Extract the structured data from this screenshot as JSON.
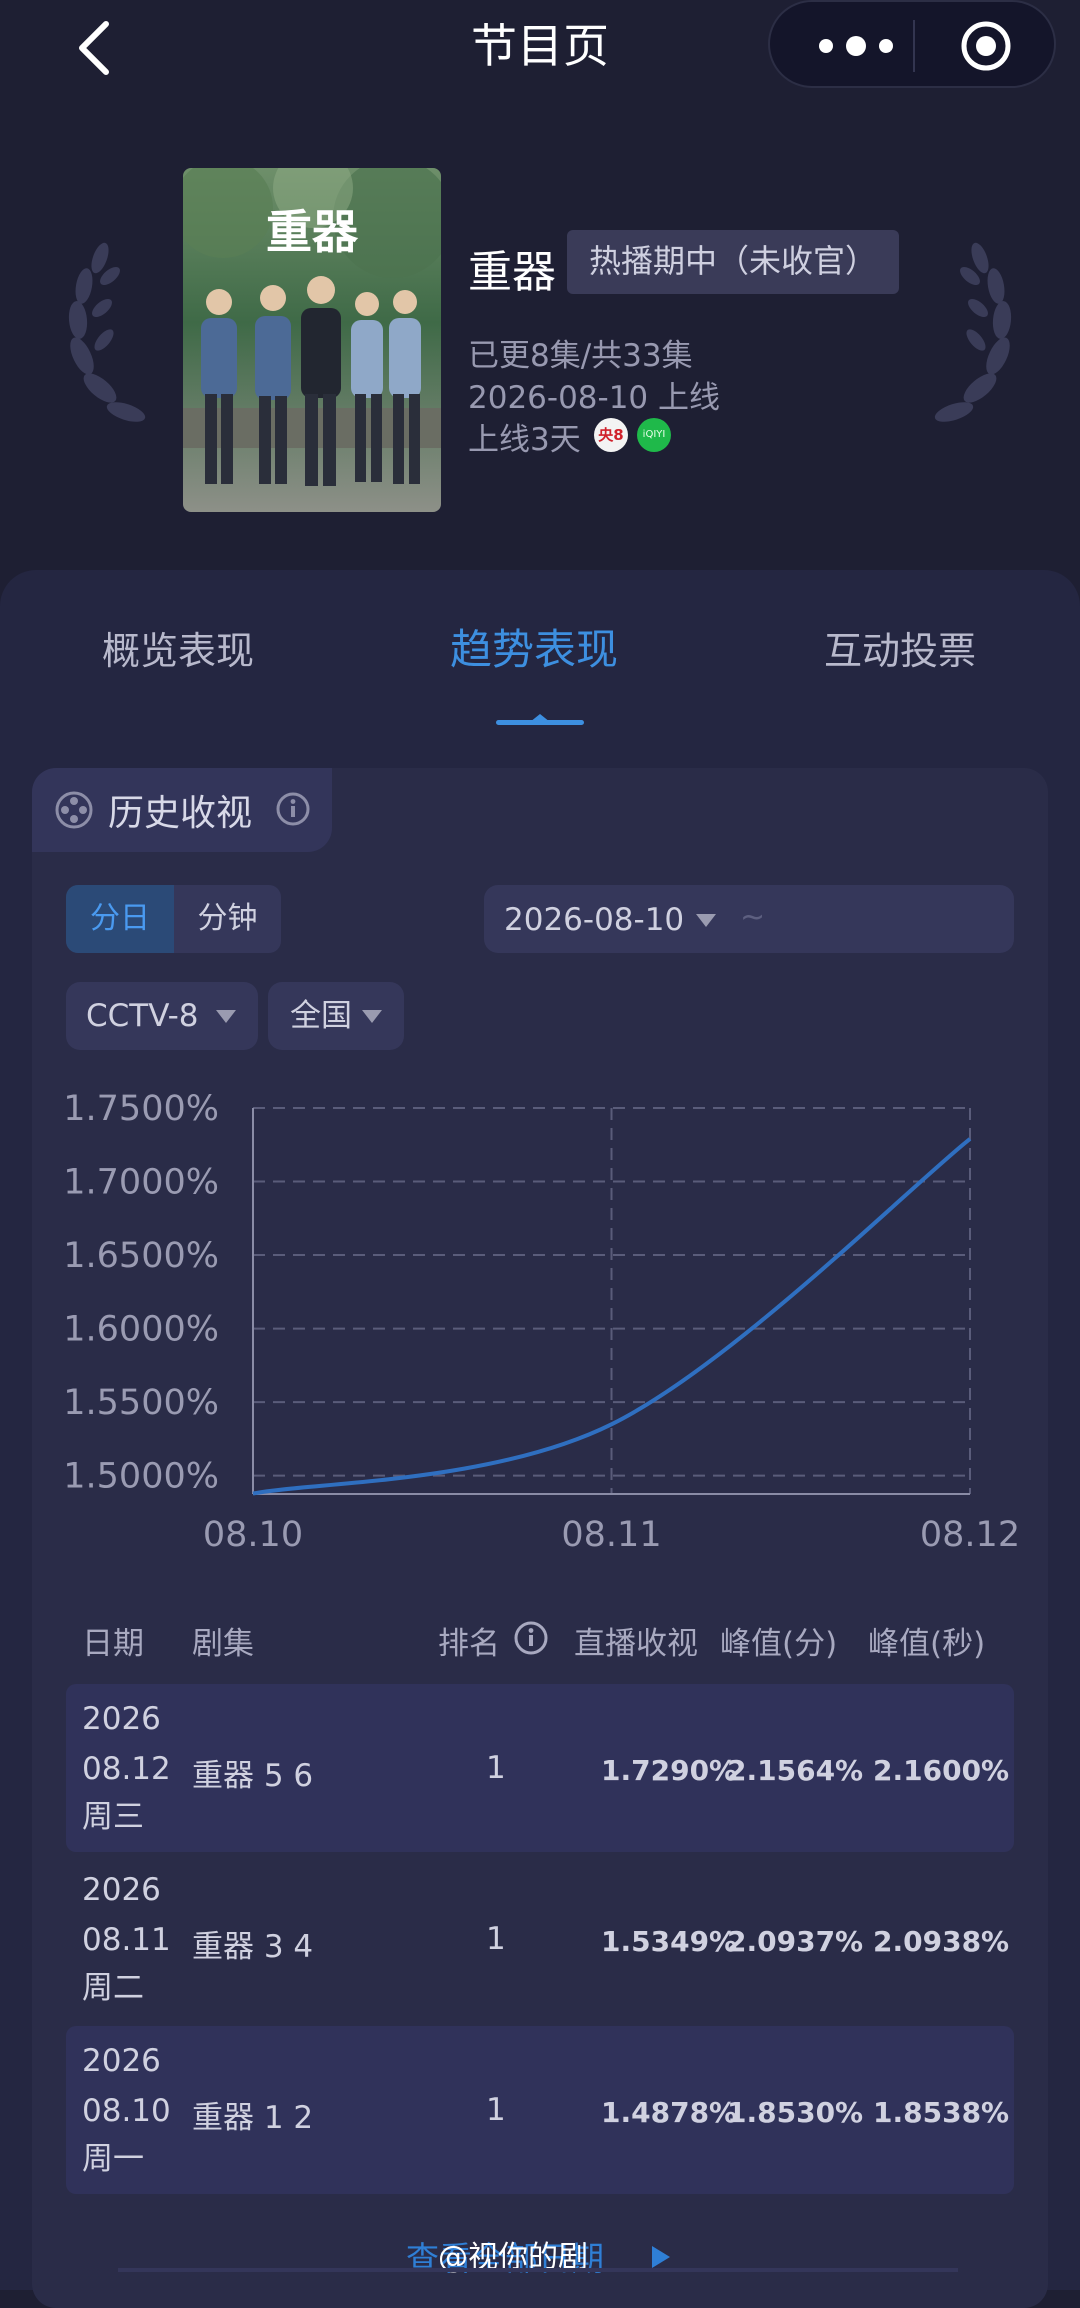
{
  "header": {
    "title": "节目页"
  },
  "show": {
    "poster_title": "重器",
    "name": "重器",
    "status": "热播期中（未收官）",
    "episodes": "已更8集/共33集",
    "release": "2026-08-10 上线",
    "online_days": "上线3天",
    "platform_badges": [
      "央8",
      "iQIYI"
    ]
  },
  "tabs": [
    {
      "label": "概览表现",
      "active": false
    },
    {
      "label": "趋势表现",
      "active": true
    },
    {
      "label": "互动投票",
      "active": false
    }
  ],
  "card": {
    "title": "历史收视"
  },
  "controls": {
    "granularity": [
      "分日",
      "分钟"
    ],
    "date_start": "2026-08-10",
    "date_separator": "~",
    "channel": "CCTV-8",
    "region": "全国"
  },
  "chart_data": {
    "type": "line",
    "x": [
      "08.10",
      "08.11",
      "08.12"
    ],
    "series": [
      {
        "values": [
          1.4878,
          1.5349,
          1.729
        ]
      }
    ],
    "yticks": [
      "1.7500%",
      "1.7000%",
      "1.6500%",
      "1.6000%",
      "1.5500%",
      "1.5000%"
    ],
    "ylim": [
      1.4875,
      1.75
    ],
    "grid": true,
    "color": "#2f6fc0"
  },
  "table": {
    "headers": [
      "日期",
      "剧集",
      "排名",
      "直播收视",
      "峰值(分)",
      "峰值(秒)"
    ],
    "rows": [
      {
        "year": "2026",
        "date": "08.12",
        "weekday": "周三",
        "episode": "重器 5 6",
        "rank": "1",
        "live": "1.7290%",
        "peak_min": "2.1564%",
        "peak_sec": "2.1600%"
      },
      {
        "year": "2026",
        "date": "08.11",
        "weekday": "周二",
        "episode": "重器 3 4",
        "rank": "1",
        "live": "1.5349%",
        "peak_min": "2.0937%",
        "peak_sec": "2.0938%"
      },
      {
        "year": "2026",
        "date": "08.10",
        "weekday": "周一",
        "episode": "重器 1 2",
        "rank": "1",
        "live": "1.4878%",
        "peak_min": "1.8530%",
        "peak_sec": "1.8538%"
      }
    ]
  },
  "footer": {
    "link": "查看全部日期",
    "watermark": "@视你的剧"
  }
}
